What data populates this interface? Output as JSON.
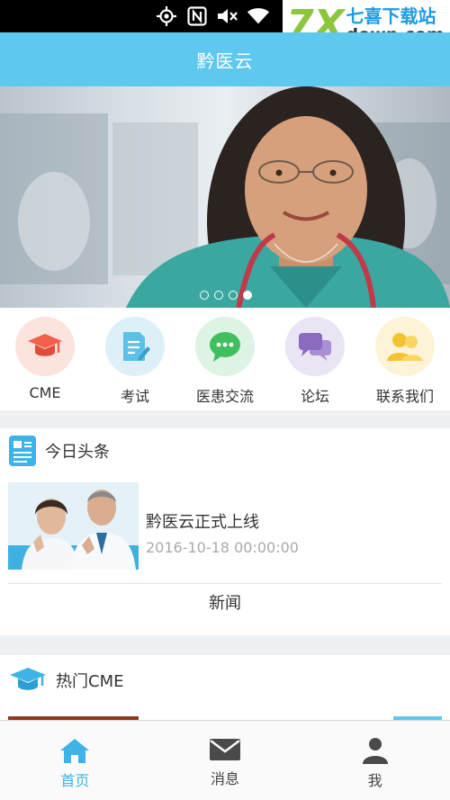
{
  "app": {
    "title": "黔医云"
  },
  "status_bar": {
    "icons": [
      "location-target-icon",
      "nfc-icon",
      "mute-icon",
      "wifi-icon"
    ]
  },
  "watermark": {
    "brand_mark": "7X",
    "text_top": "七喜下载站",
    "text_bottom": "down.com"
  },
  "banner": {
    "dots_count": 4,
    "active_dot": 4
  },
  "menu": {
    "items": [
      {
        "label": "CME",
        "icon": "graduation-cap-icon",
        "bg": "#fde3de",
        "color": "#f0604a"
      },
      {
        "label": "考试",
        "icon": "exam-sheet-icon",
        "bg": "#ddf0f8",
        "color": "#5cc0e8"
      },
      {
        "label": "医患交流",
        "icon": "chat-bubble-icon",
        "bg": "#ddf3e3",
        "color": "#3fbf60"
      },
      {
        "label": "论坛",
        "icon": "forum-icon",
        "bg": "#ebe4f4",
        "color": "#8b6bbf"
      },
      {
        "label": "联系我们",
        "icon": "contacts-icon",
        "bg": "#fdf3d6",
        "color": "#f4c430"
      }
    ]
  },
  "headlines": {
    "section_title": "今日头条",
    "items": [
      {
        "title": "黔医云正式上线",
        "time": "2016-10-18 00:00:00"
      }
    ],
    "more_label": "新闻"
  },
  "hot_cme": {
    "section_title": "热门CME"
  },
  "tabbar": {
    "tabs": [
      {
        "label": "首页",
        "icon": "home-icon",
        "active": true
      },
      {
        "label": "消息",
        "icon": "mail-icon",
        "active": false
      },
      {
        "label": "我",
        "icon": "user-icon",
        "active": false
      }
    ]
  },
  "colors": {
    "accent": "#5ec8ef",
    "active_tab": "#3db3e6",
    "background": "#eef1f4"
  }
}
